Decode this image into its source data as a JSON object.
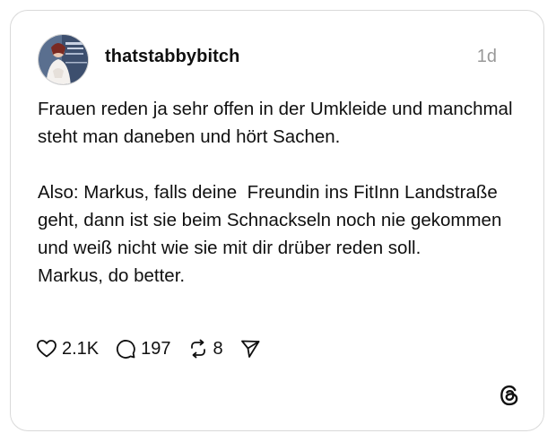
{
  "post": {
    "username": "thatstabbybitch",
    "timestamp": "1d",
    "paragraph_1": "Frauen reden ja sehr offen in der Umkleide und manchmal steht man daneben und hört Sachen.",
    "paragraph_2": "Also: Markus, falls deine  Freundin ins FitInn Landstraße geht, dann ist sie beim Schnackseln noch nie gekommen und weiß nicht wie sie mit dir drüber reden soll.\nMarkus, do better."
  },
  "actions": {
    "likes": "2.1K",
    "replies": "197",
    "reposts": "8"
  },
  "icons": {
    "like": "heart-icon",
    "reply": "speech-bubble-icon",
    "repost": "repost-icon",
    "share": "send-icon",
    "brand": "threads-logo-icon"
  }
}
